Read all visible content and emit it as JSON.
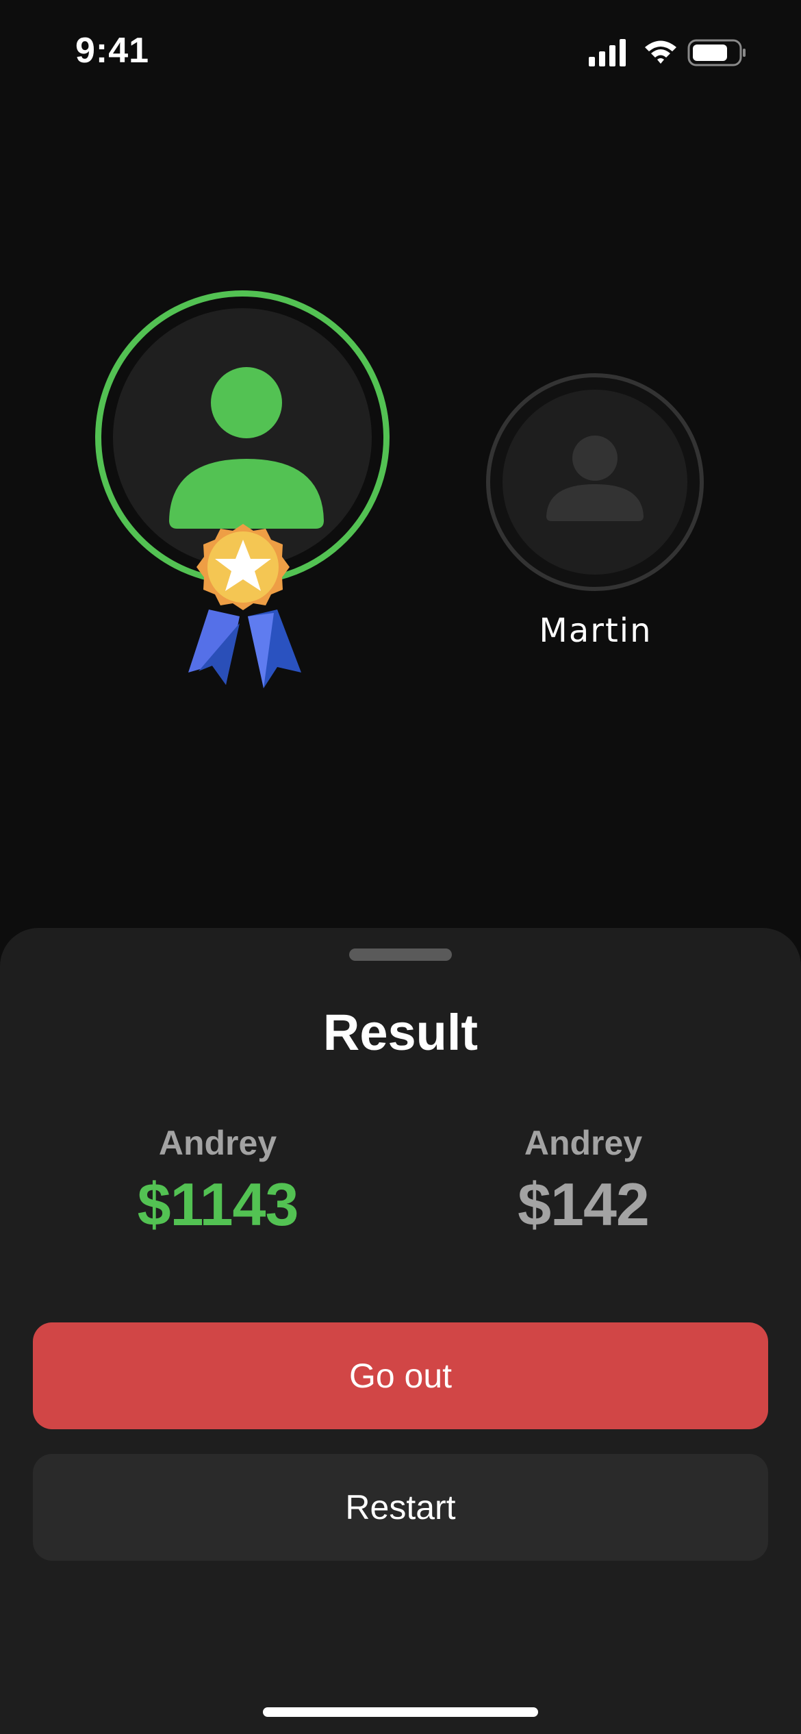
{
  "status_bar": {
    "time": "9:41",
    "icons": [
      "signal-icon",
      "wifi-icon",
      "battery-icon"
    ]
  },
  "players": {
    "winner": {
      "avatar_icon": "person-icon",
      "badge_icon": "medal-icon",
      "ring_color": "#53c253"
    },
    "opponent": {
      "name": "Martin",
      "avatar_icon": "person-icon"
    }
  },
  "result": {
    "title": "Result",
    "scores": [
      {
        "name": "Andrey",
        "amount": "$1143",
        "status": "winner"
      },
      {
        "name": "Andrey",
        "amount": "$142",
        "status": "loser"
      }
    ]
  },
  "actions": {
    "go_out_label": "Go out",
    "restart_label": "Restart"
  },
  "colors": {
    "accent_green": "#53c253",
    "danger_red": "#d14646",
    "background": "#0d0d0d",
    "sheet": "#1e1e1e"
  }
}
